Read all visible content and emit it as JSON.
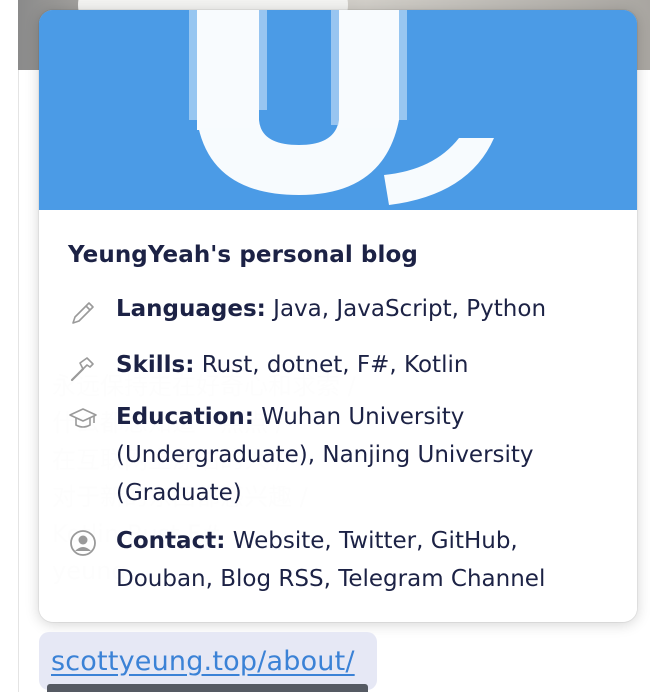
{
  "card": {
    "title": "YeungYeah's personal blog",
    "banner_color": "#4b9be6",
    "rows": [
      {
        "label": "Languages:",
        "value": "Java, JavaScript, Python",
        "icon": "pencil-icon"
      },
      {
        "label": "Skills:",
        "value": "Rust, dotnet, F#, Kotlin",
        "icon": "hammer-icon"
      },
      {
        "label": "Education:",
        "value": "Wuhan University (Undergraduate), Nanjing University (Graduate)",
        "icon": "graduation-cap-icon"
      },
      {
        "label": "Contact:",
        "value": "Website, Twitter, GitHub, Douban, Blog RSS, Telegram Channel",
        "icon": "user-circle-icon"
      }
    ]
  },
  "link": {
    "url_text": "scottyeung.top/about/"
  },
  "colors": {
    "text": "#1c2245",
    "link": "#3b82d6",
    "chip": "#e6e8f5"
  }
}
